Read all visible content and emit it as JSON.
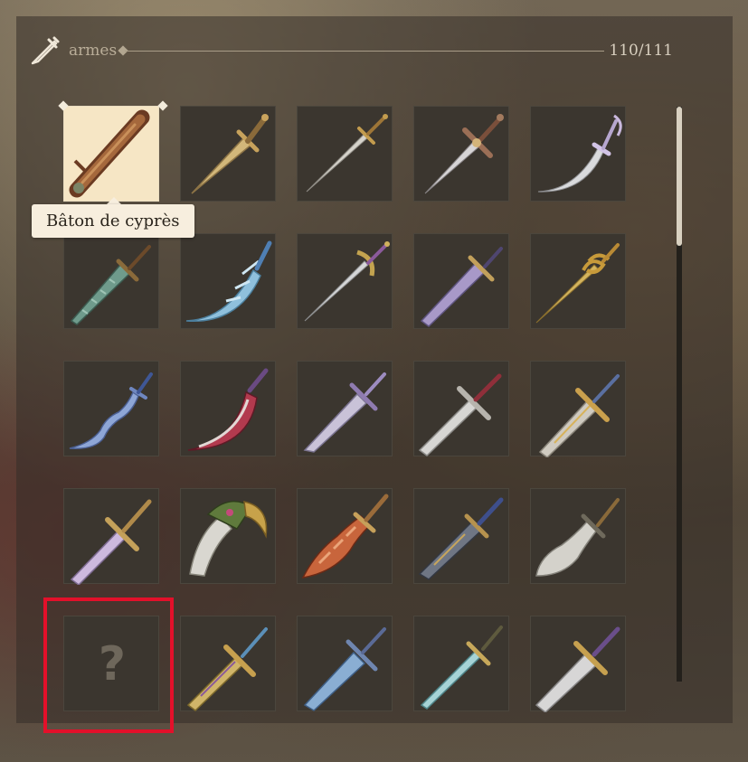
{
  "header": {
    "category_icon": "sword-icon",
    "category_label": "armes",
    "progress_text": "110/111",
    "progress_fraction": 0.991
  },
  "tooltip": {
    "text": "Bâton de cyprès"
  },
  "grid": {
    "columns": 5,
    "rows": 5,
    "selected_index": 0,
    "items": [
      {
        "icon": "wooden-staff-icon",
        "status": "selected"
      },
      {
        "icon": "golden-dagger-icon",
        "status": "unlocked"
      },
      {
        "icon": "slim-sword-icon",
        "status": "unlocked"
      },
      {
        "icon": "cross-guard-sword-icon",
        "status": "unlocked"
      },
      {
        "icon": "ribboned-scimitar-icon",
        "status": "unlocked"
      },
      {
        "icon": "jade-serrated-blade-icon",
        "status": "unlocked"
      },
      {
        "icon": "ice-crystal-blade-icon",
        "status": "unlocked"
      },
      {
        "icon": "basket-hilt-rapier-icon",
        "status": "unlocked"
      },
      {
        "icon": "violet-broadsword-icon",
        "status": "unlocked"
      },
      {
        "icon": "spiral-golden-rapier-icon",
        "status": "unlocked"
      },
      {
        "icon": "wavy-blue-blade-icon",
        "status": "unlocked"
      },
      {
        "icon": "crimson-curved-blade-icon",
        "status": "unlocked"
      },
      {
        "icon": "lilac-scimitar-icon",
        "status": "unlocked"
      },
      {
        "icon": "ruby-longsword-icon",
        "status": "unlocked"
      },
      {
        "icon": "golden-cross-sword-icon",
        "status": "unlocked"
      },
      {
        "icon": "lavender-longsword-icon",
        "status": "unlocked"
      },
      {
        "icon": "horned-green-blade-icon",
        "status": "unlocked"
      },
      {
        "icon": "flame-blade-icon",
        "status": "unlocked"
      },
      {
        "icon": "dark-notched-blade-icon",
        "status": "unlocked"
      },
      {
        "icon": "cleaver-sword-icon",
        "status": "unlocked"
      },
      {
        "icon": "question-mark-icon",
        "status": "locked",
        "label": "?"
      },
      {
        "icon": "ornate-gold-sword-icon",
        "status": "unlocked"
      },
      {
        "icon": "steel-blue-sword-icon",
        "status": "unlocked"
      },
      {
        "icon": "teal-rapier-icon",
        "status": "unlocked"
      },
      {
        "icon": "silver-broadsword-icon",
        "status": "unlocked"
      }
    ]
  },
  "colors": {
    "highlight": "#e3102a",
    "selected_cell": "#f6e6c5",
    "cell": "#3b362f"
  },
  "scrollbar": {
    "position_fraction": 0.0
  }
}
